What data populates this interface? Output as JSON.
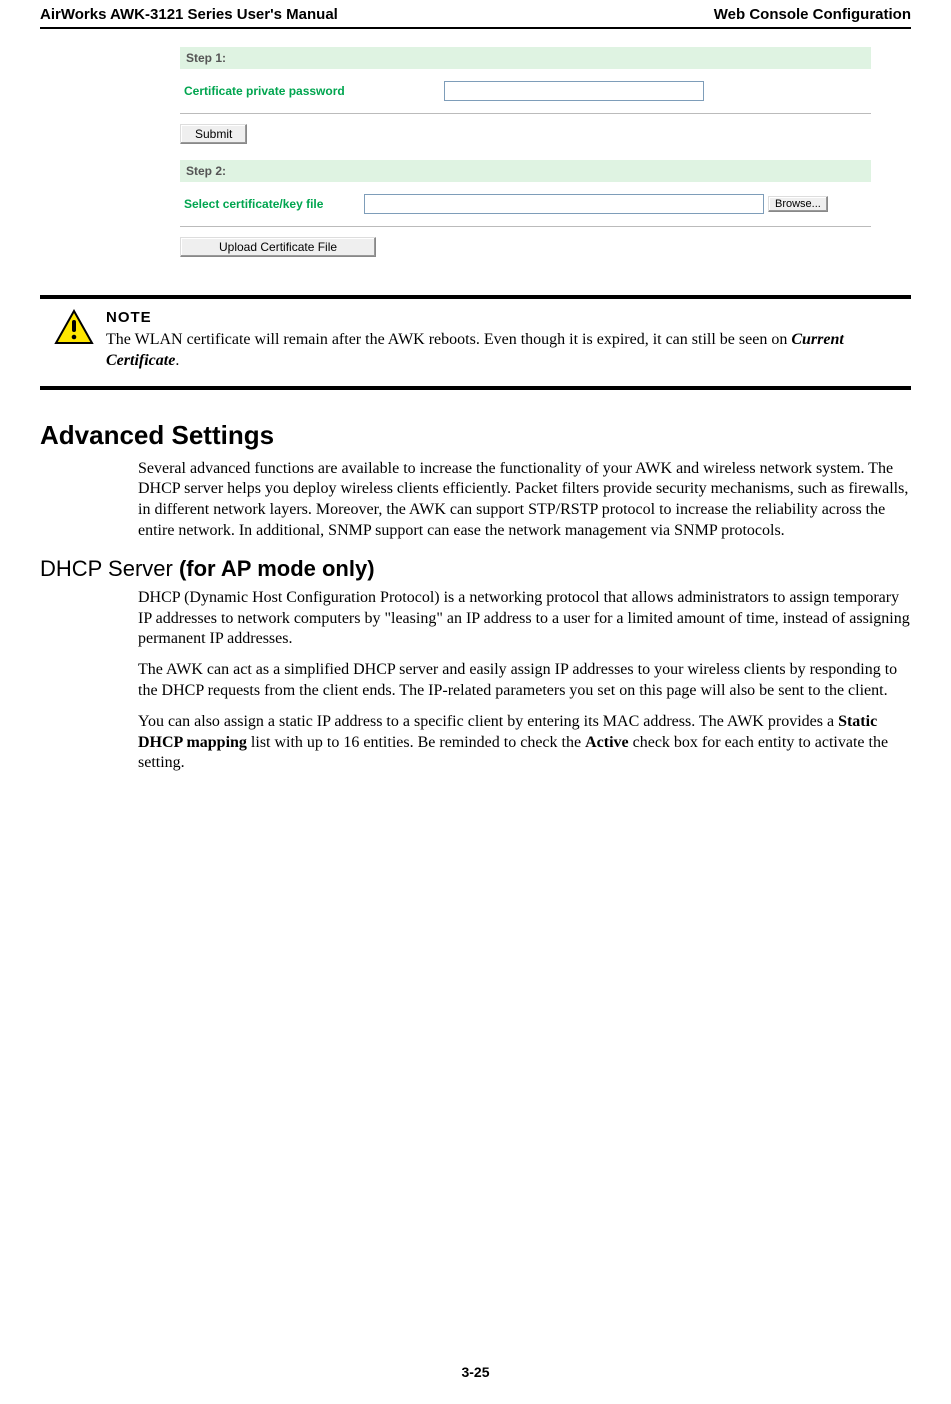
{
  "header": {
    "left": "AirWorks AWK-3121 Series User's Manual",
    "right": "Web Console Configuration"
  },
  "screenshot": {
    "step1": {
      "title": "Step 1:",
      "label": "Certificate private password",
      "input_value": "",
      "submit": "Submit"
    },
    "step2": {
      "title": "Step 2:",
      "label": "Select certificate/key file",
      "input_value": "",
      "browse": "Browse...",
      "upload": "Upload Certificate File"
    }
  },
  "note": {
    "title": "NOTE",
    "body_prefix": "The WLAN certificate will remain after the AWK reboots. Even though it is expired, it can still be seen on ",
    "body_emph": "Current Certificate",
    "body_suffix": "."
  },
  "advanced": {
    "heading": "Advanced Settings",
    "para1": "Several advanced functions are available to increase the functionality of your AWK and wireless network system. The DHCP server helps you deploy wireless clients efficiently. Packet filters provide security mechanisms, such as firewalls, in different network layers. Moreover, the AWK can support STP/RSTP protocol to increase the reliability across the entire network. In additional, SNMP support can ease the network management via SNMP protocols."
  },
  "dhcp": {
    "heading_plain": "DHCP Server ",
    "heading_bold": "(for AP mode only)",
    "para1": "DHCP (Dynamic Host Configuration Protocol) is a networking protocol that allows administrators to assign temporary IP addresses to network computers by \"leasing\" an IP address to a user for a limited amount of time, instead of assigning permanent IP addresses.",
    "para2": "The AWK can act as a simplified DHCP server and easily assign IP addresses to your wireless clients by responding to the DHCP requests from the client ends. The IP-related parameters you set on this page will also be sent to the client.",
    "para3_pre": "You can also assign a static IP address to a specific client by entering its MAC address. The AWK provides a ",
    "para3_b1": "Static DHCP mapping",
    "para3_mid": " list with up to 16 entities. Be reminded to check the ",
    "para3_b2": "Active",
    "para3_post": " check box for each entity to activate the setting."
  },
  "page_number": "3-25"
}
